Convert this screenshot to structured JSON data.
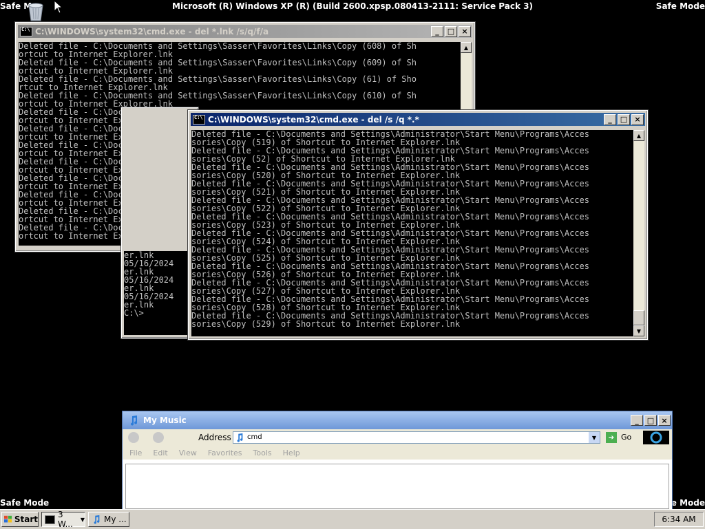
{
  "desktop": {
    "banner": "Microsoft (R) Windows XP (R) (Build 2600.xpsp.080413-2111: Service Pack 3)",
    "safe_mode_top_left": "Safe M",
    "safe_mode_top_right": "Safe Mode",
    "safe_mode_bottom_left": "Safe Mode",
    "safe_mode_bottom_right": "fe Mode"
  },
  "window_back": {
    "title": "C:\\WINDOWS\\system32\\cmd.exe - del *.lnk /s/q/f/a",
    "lines": [
      "Deleted file - C:\\Documents and Settings\\Sasser\\Favorites\\Links\\Copy (608) of Sh",
      "ortcut to Internet Explorer.lnk",
      "Deleted file - C:\\Documents and Settings\\Sasser\\Favorites\\Links\\Copy (609) of Sh",
      "ortcut to Internet Explorer.lnk",
      "Deleted file - C:\\Documents and Settings\\Sasser\\Favorites\\Links\\Copy (61) of Sho",
      "rtcut to Internet Explorer.lnk",
      "Deleted file - C:\\Documents and Settings\\Sasser\\Favorites\\Links\\Copy (610) of Sh",
      "ortcut to Internet Explorer.lnk",
      "Deleted file - C:\\Documents and",
      "ortcut to Internet Explorer.lnk",
      "Deleted file - C:\\Documents and",
      "ortcut to Internet Explorer.lnk",
      "Deleted file - C:\\Documents and",
      "ortcut to Internet Explorer.lnk",
      "Deleted file - C:\\Documents and",
      "ortcut to Internet Explorer.lnk",
      "Deleted file - C:\\Documents and",
      "ortcut to Internet Explorer.lnk",
      "Deleted file - C:\\Documents and",
      "ortcut to Internet Explorer.lnk",
      "Deleted file - C:\\Documents and",
      "ortcut to Internet Explorer.lnk",
      "Deleted file - C:\\Documents and",
      "ortcut to Internet Explorer.lnk"
    ]
  },
  "window_middle": {
    "lines": [
      "er.lnk",
      "05/16/2024",
      "er.lnk",
      "05/16/2024",
      "er.lnk",
      "05/16/2024",
      "er.lnk",
      "",
      "C:\\>"
    ]
  },
  "window_front": {
    "title": "C:\\WINDOWS\\system32\\cmd.exe - del /s /q *.*",
    "lines": [
      "Deleted file - C:\\Documents and Settings\\Administrator\\Start Menu\\Programs\\Acces",
      "sories\\Copy (519) of Shortcut to Internet Explorer.lnk",
      "Deleted file - C:\\Documents and Settings\\Administrator\\Start Menu\\Programs\\Acces",
      "sories\\Copy (52) of Shortcut to Internet Explorer.lnk",
      "Deleted file - C:\\Documents and Settings\\Administrator\\Start Menu\\Programs\\Acces",
      "sories\\Copy (520) of Shortcut to Internet Explorer.lnk",
      "Deleted file - C:\\Documents and Settings\\Administrator\\Start Menu\\Programs\\Acces",
      "sories\\Copy (521) of Shortcut to Internet Explorer.lnk",
      "Deleted file - C:\\Documents and Settings\\Administrator\\Start Menu\\Programs\\Acces",
      "sories\\Copy (522) of Shortcut to Internet Explorer.lnk",
      "Deleted file - C:\\Documents and Settings\\Administrator\\Start Menu\\Programs\\Acces",
      "sories\\Copy (523) of Shortcut to Internet Explorer.lnk",
      "Deleted file - C:\\Documents and Settings\\Administrator\\Start Menu\\Programs\\Acces",
      "sories\\Copy (524) of Shortcut to Internet Explorer.lnk",
      "Deleted file - C:\\Documents and Settings\\Administrator\\Start Menu\\Programs\\Acces",
      "sories\\Copy (525) of Shortcut to Internet Explorer.lnk",
      "Deleted file - C:\\Documents and Settings\\Administrator\\Start Menu\\Programs\\Acces",
      "sories\\Copy (526) of Shortcut to Internet Explorer.lnk",
      "Deleted file - C:\\Documents and Settings\\Administrator\\Start Menu\\Programs\\Acces",
      "sories\\Copy (527) of Shortcut to Internet Explorer.lnk",
      "Deleted file - C:\\Documents and Settings\\Administrator\\Start Menu\\Programs\\Acces",
      "sories\\Copy (528) of Shortcut to Internet Explorer.lnk",
      "Deleted file - C:\\Documents and Settings\\Administrator\\Start Menu\\Programs\\Acces",
      "sories\\Copy (529) of Shortcut to Internet Explorer.lnk"
    ]
  },
  "explorer": {
    "title": "My Music",
    "address_label": "Address",
    "address_value": "cmd",
    "go_label": "Go",
    "menu": [
      "File",
      "Edit",
      "View",
      "Favorites",
      "Tools",
      "Help"
    ]
  },
  "taskbar": {
    "start_label": "Start",
    "buttons": [
      "3 W...",
      "My ..."
    ],
    "clock": "6:34 AM"
  },
  "window_controls": {
    "minimize": "_",
    "maximize": "□",
    "close": "×"
  }
}
